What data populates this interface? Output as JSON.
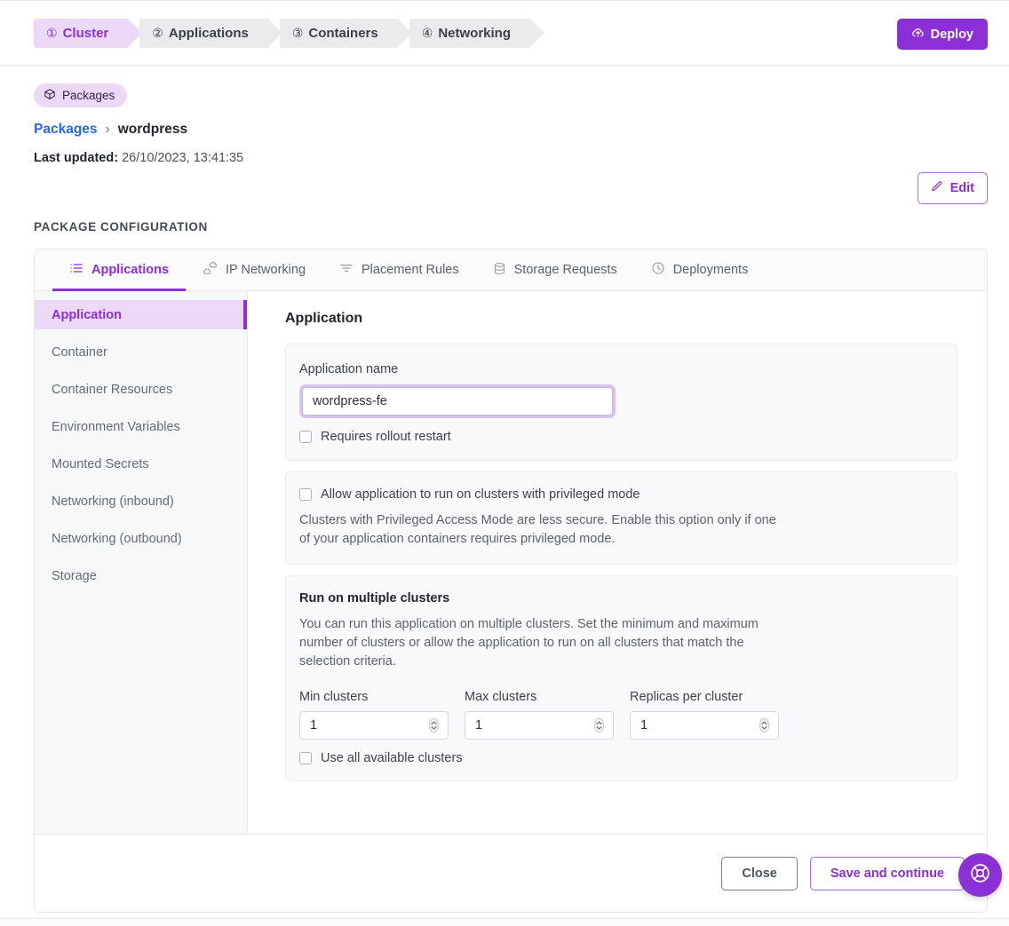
{
  "stepper": {
    "steps": [
      {
        "num": "①",
        "label": "Cluster",
        "active": true
      },
      {
        "num": "②",
        "label": "Applications",
        "active": false
      },
      {
        "num": "③",
        "label": "Containers",
        "active": false
      },
      {
        "num": "④",
        "label": "Networking",
        "active": false
      }
    ],
    "deploy_label": "Deploy"
  },
  "header": {
    "badge_label": "Packages",
    "breadcrumb_root": "Packages",
    "breadcrumb_sep": "›",
    "breadcrumb_current": "wordpress",
    "last_updated_label": "Last updated:",
    "last_updated_value": "26/10/2023, 13:41:35",
    "edit_label": "Edit"
  },
  "section_title": "PACKAGE CONFIGURATION",
  "tabs": [
    {
      "label": "Applications",
      "icon": "list-icon",
      "active": true
    },
    {
      "label": "IP Networking",
      "icon": "clouds-icon",
      "active": false
    },
    {
      "label": "Placement Rules",
      "icon": "filter-icon",
      "active": false
    },
    {
      "label": "Storage Requests",
      "icon": "database-icon",
      "active": false
    },
    {
      "label": "Deployments",
      "icon": "clock-icon",
      "active": false
    }
  ],
  "sidebar": {
    "items": [
      {
        "label": "Application",
        "active": true
      },
      {
        "label": "Container",
        "active": false
      },
      {
        "label": "Container Resources",
        "active": false
      },
      {
        "label": "Environment Variables",
        "active": false
      },
      {
        "label": "Mounted Secrets",
        "active": false
      },
      {
        "label": "Networking (inbound)",
        "active": false
      },
      {
        "label": "Networking (outbound)",
        "active": false
      },
      {
        "label": "Storage",
        "active": false
      }
    ]
  },
  "main": {
    "title": "Application",
    "app_name_label": "Application name",
    "app_name_value": "wordpress-fe",
    "app_name_placeholder": "Application name",
    "rollout_restart_label": "Requires rollout restart",
    "privileged_label": "Allow application to run on clusters with privileged mode",
    "privileged_desc": "Clusters with Privileged Access Mode are less secure. Enable this option only if one of your application containers requires privileged mode.",
    "clusters_title": "Run on multiple clusters",
    "clusters_desc": "You can run this application on multiple clusters. Set the minimum and maximum number of clusters or allow the application to run on all clusters that match the selection criteria.",
    "min_clusters_label": "Min clusters",
    "min_clusters_value": "1",
    "max_clusters_label": "Max clusters",
    "max_clusters_value": "1",
    "replicas_label": "Replicas per cluster",
    "replicas_value": "1",
    "use_all_label": "Use all available clusters"
  },
  "footer": {
    "close_label": "Close",
    "save_label": "Save and continue"
  },
  "fab": {
    "icon": "help-lifering-icon"
  },
  "colors": {
    "accent": "#8b2fd6",
    "accent_soft": "#ecd9f7",
    "link": "#2668f5",
    "text": "#22262e",
    "muted": "#656b76"
  }
}
